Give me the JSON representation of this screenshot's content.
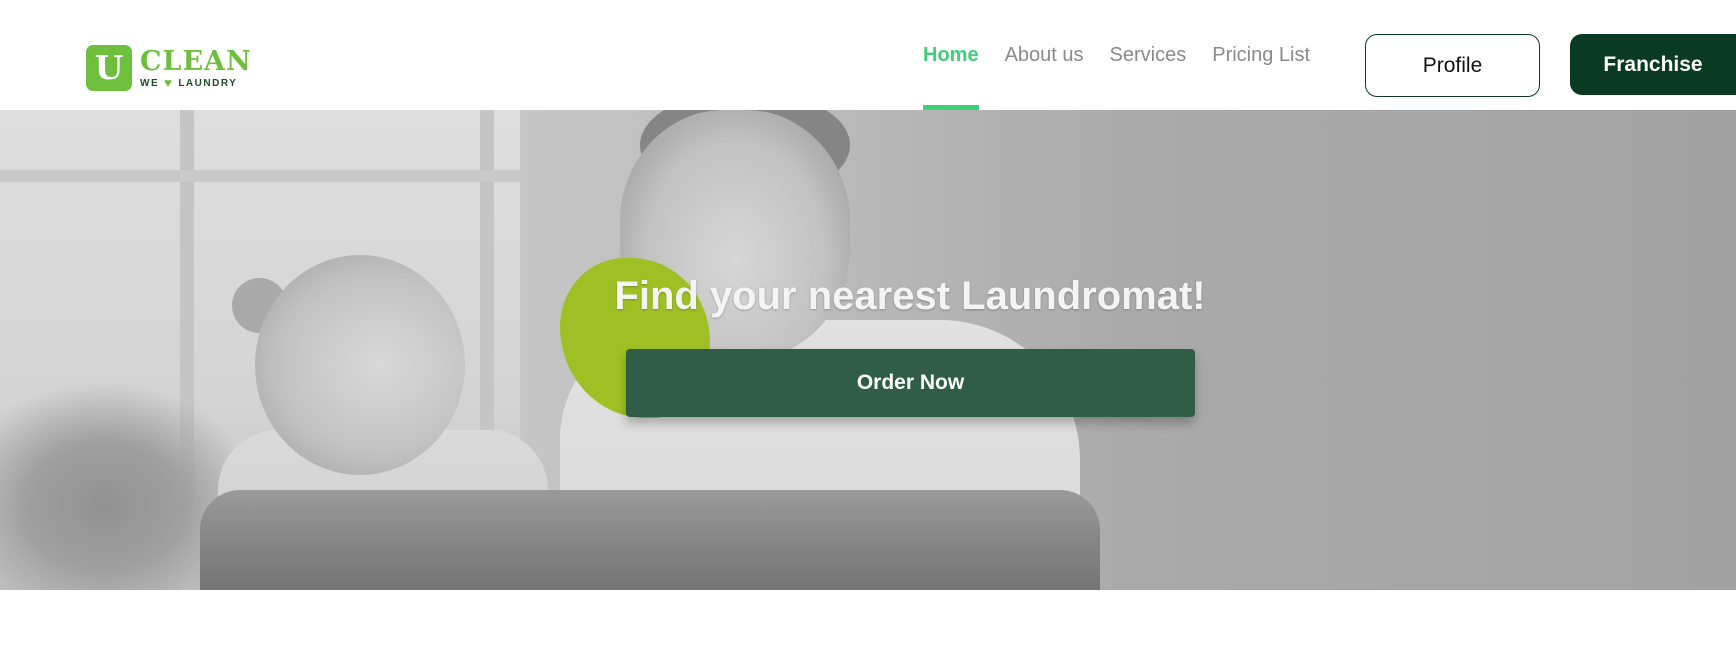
{
  "brand": {
    "logo_letter": "U",
    "logo_word": "CLEAN",
    "tagline_left": "WE",
    "tagline_right": "LAUNDRY",
    "colors": {
      "accent": "#6fbf3f",
      "dark": "#0b3a22",
      "active_nav": "#3fcf79"
    }
  },
  "nav": {
    "items": [
      {
        "label": "Home",
        "active": true
      },
      {
        "label": "About us",
        "active": false
      },
      {
        "label": "Services",
        "active": false
      },
      {
        "label": "Pricing List",
        "active": false
      }
    ]
  },
  "header": {
    "profile_label": "Profile",
    "franchise_label": "Franchise"
  },
  "hero": {
    "title": "Find your nearest Laundromat!",
    "cta_label": "Order Now"
  }
}
